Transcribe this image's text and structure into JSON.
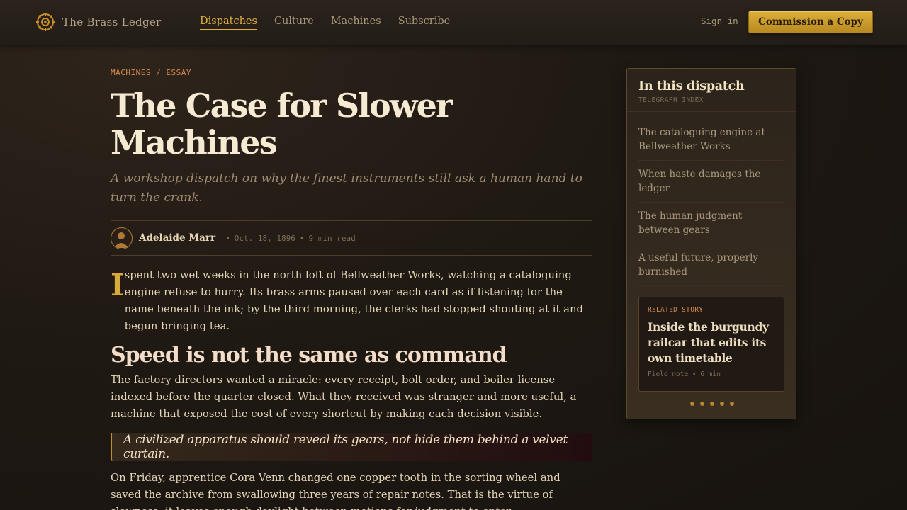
{
  "header": {
    "brand": "The Brass Ledger",
    "nav": [
      {
        "label": "Dispatches",
        "active": true
      },
      {
        "label": "Culture",
        "active": false
      },
      {
        "label": "Machines",
        "active": false
      },
      {
        "label": "Subscribe",
        "active": false
      }
    ],
    "signin_label": "Sign in",
    "cta_label": "Commission a Copy",
    "brand_icon": "gear-icon"
  },
  "article": {
    "kicker": "MACHINES / ESSAY",
    "title": "The Case for Slower Machines",
    "dek": "A workshop dispatch on why the finest instruments still ask a human hand to turn the crank.",
    "author": "Adelaide Marr",
    "date": "Oct. 18, 1896",
    "read_time": "9 min read",
    "dropcap": "I",
    "lead": "spent two wet weeks in the north loft of Bellweather Works, watching a cataloguing engine refuse to hurry. Its brass arms paused over each card as if listening for the name beneath the ink; by the third morning, the clerks had stopped shouting at it and begun bringing tea.",
    "heading": "Speed is not the same as command",
    "paragraph2": "The factory directors wanted a miracle: every receipt, bolt order, and boiler license indexed before the quarter closed. What they received was stranger and more useful, a machine that exposed the cost of every shortcut by making each decision visible.",
    "pullquote": "A civilized apparatus should reveal its gears, not hide them behind a velvet curtain.",
    "paragraph3": "On Friday, apprentice Cora Venn changed one copper tooth in the sorting wheel and saved the archive from swallowing three years of repair notes. That is the virtue of slowness: it leaves enough daylight between motions for judgment to enter."
  },
  "sidebar": {
    "title": "In this dispatch",
    "subtitle": "TELEGRAPH INDEX",
    "toc": [
      "The cataloguing engine at Bellweather Works",
      "When haste damages the ledger",
      "The human judgment between gears",
      "A useful future, properly burnished"
    ],
    "related": {
      "label": "RELATED STORY",
      "title": "Inside the burgundy railcar that edits its own timetable",
      "meta": "Field note • 6 min"
    },
    "carousel_pages": 5
  },
  "colors": {
    "accent": "#e0b13f",
    "kicker": "#d98a4e",
    "background": "#1f1913"
  }
}
